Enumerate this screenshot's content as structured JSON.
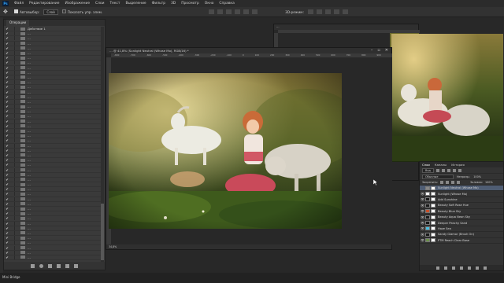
{
  "app": {
    "logo": "Ps",
    "menu": [
      "Файл",
      "Редактирование",
      "Изображение",
      "Слои",
      "Текст",
      "Выделение",
      "Фильтр",
      "3D",
      "Просмотр",
      "Окно",
      "Справка"
    ]
  },
  "options": {
    "autoselect_label": "Автовыбор:",
    "autoselect_value": "Слой",
    "show_controls_label": "Показать упр. элем.",
    "mode_3d_label": "3D-режим:"
  },
  "actions_panel": {
    "tab_label": "Операции",
    "rows": [
      {
        "check": "✔",
        "arrow": "",
        "label": "Действие 1",
        "indent": false,
        "selected": false
      },
      {
        "check": "✔",
        "arrow": "",
        "label": "…",
        "indent": false,
        "selected": false
      },
      {
        "check": "✔",
        "arrow": "",
        "label": "…",
        "indent": false,
        "selected": false
      },
      {
        "check": "✔",
        "arrow": "",
        "label": "…",
        "indent": false,
        "selected": false
      },
      {
        "check": "✔",
        "arrow": "",
        "label": "…",
        "indent": false,
        "selected": false
      },
      {
        "check": "✔",
        "arrow": "",
        "label": "…",
        "indent": false,
        "selected": false
      },
      {
        "check": "✔",
        "arrow": "",
        "label": "…",
        "indent": false,
        "selected": false
      },
      {
        "check": "✔",
        "arrow": "",
        "label": "…",
        "indent": false,
        "selected": false
      },
      {
        "check": "✔",
        "arrow": "",
        "label": "…",
        "indent": false,
        "selected": false
      },
      {
        "check": "✔",
        "arrow": "",
        "label": "…",
        "indent": false,
        "selected": false
      },
      {
        "check": "✔",
        "arrow": "",
        "label": "…",
        "indent": false,
        "selected": false
      },
      {
        "check": "✔",
        "arrow": "",
        "label": "…",
        "indent": false,
        "selected": false
      },
      {
        "check": "✔",
        "arrow": "",
        "label": "…",
        "indent": false,
        "selected": false
      },
      {
        "check": "✔",
        "arrow": "",
        "label": "…",
        "indent": false,
        "selected": false
      },
      {
        "check": "✔",
        "arrow": "",
        "label": "…",
        "indent": false,
        "selected": false
      },
      {
        "check": "✔",
        "arrow": "",
        "label": "…",
        "indent": false,
        "selected": false
      },
      {
        "check": "✔",
        "arrow": "",
        "label": "…",
        "indent": false,
        "selected": false
      },
      {
        "check": "✔",
        "arrow": "",
        "label": "…",
        "indent": false,
        "selected": false
      },
      {
        "check": "✔",
        "arrow": "",
        "label": "…",
        "indent": false,
        "selected": false
      },
      {
        "check": "✔",
        "arrow": "",
        "label": "…",
        "indent": false,
        "selected": false
      },
      {
        "check": "✔",
        "arrow": "",
        "label": "…",
        "indent": false,
        "selected": false
      },
      {
        "check": "✔",
        "arrow": "",
        "label": "…",
        "indent": false,
        "selected": false
      },
      {
        "check": "✔",
        "arrow": "",
        "label": "…",
        "indent": false,
        "selected": false
      },
      {
        "check": "✔",
        "arrow": "",
        "label": "…",
        "indent": false,
        "selected": false
      },
      {
        "check": "✔",
        "arrow": "",
        "label": "…",
        "indent": false,
        "selected": false
      },
      {
        "check": "✔",
        "arrow": "",
        "label": "…",
        "indent": false,
        "selected": false
      },
      {
        "check": "✔",
        "arrow": "",
        "label": "…",
        "indent": false,
        "selected": false
      },
      {
        "check": "✔",
        "arrow": "",
        "label": "…",
        "indent": false,
        "selected": false
      },
      {
        "check": "✔",
        "arrow": "",
        "label": "…",
        "indent": false,
        "selected": false
      },
      {
        "check": "✔",
        "arrow": "",
        "label": "…",
        "indent": false,
        "selected": false
      },
      {
        "check": "✔",
        "arrow": "",
        "label": "…",
        "indent": false,
        "selected": false
      },
      {
        "check": "✔",
        "arrow": "",
        "label": "…",
        "indent": false,
        "selected": false
      },
      {
        "check": "✔",
        "arrow": "",
        "label": "…",
        "indent": false,
        "selected": false
      },
      {
        "check": "✔",
        "arrow": "",
        "label": "…",
        "indent": false,
        "selected": false
      },
      {
        "check": "✔",
        "arrow": "",
        "label": "…",
        "indent": false,
        "selected": false
      },
      {
        "check": "✔",
        "arrow": "",
        "label": "…",
        "indent": false,
        "selected": false
      },
      {
        "check": "✔",
        "arrow": "",
        "label": "…",
        "indent": false,
        "selected": false
      },
      {
        "check": "✔",
        "arrow": "",
        "label": "…",
        "indent": false,
        "selected": false
      },
      {
        "check": "✔",
        "arrow": "",
        "label": "…",
        "indent": false,
        "selected": false
      },
      {
        "check": "✔",
        "arrow": "",
        "label": "…",
        "indent": false,
        "selected": false
      },
      {
        "check": "✔",
        "arrow": "",
        "label": "…",
        "indent": false,
        "selected": false
      },
      {
        "check": "✔",
        "arrow": "",
        "label": "…",
        "indent": false,
        "selected": false
      },
      {
        "check": "✔",
        "arrow": "",
        "label": "…",
        "indent": false,
        "selected": false
      },
      {
        "check": "✔",
        "arrow": "",
        "label": "…",
        "indent": false,
        "selected": false
      },
      {
        "check": "✔",
        "arrow": "",
        "label": "…",
        "indent": false,
        "selected": false
      },
      {
        "check": "✔",
        "arrow": "",
        "label": "…",
        "indent": false,
        "selected": false
      },
      {
        "check": "✔",
        "arrow": "",
        "label": "…",
        "indent": false,
        "selected": false
      },
      {
        "check": "✔",
        "arrow": "",
        "label": "…",
        "indent": false,
        "selected": false
      }
    ],
    "footer_icons": [
      "stop-icon",
      "record-icon",
      "play-icon",
      "new-set-icon",
      "new-action-icon",
      "trash-icon"
    ]
  },
  "document_main": {
    "title": "… @ 41,8% (Sunlight Neutral (Whose Mo), RGB/16) *",
    "ruler_ticks": [
      "-800",
      "-700",
      "-600",
      "-500",
      "-400",
      "-300",
      "-200",
      "-100",
      "0",
      "100",
      "200",
      "300",
      "400",
      "500",
      "600",
      "700",
      "800",
      "900",
      "1000",
      "1100",
      "1200",
      "1300"
    ],
    "status": "34,8%"
  },
  "document_second": {
    "title": "…"
  },
  "layers_panel": {
    "tabs": [
      "Слои",
      "Каналы",
      "История"
    ],
    "filter_label": "Вид",
    "blend_mode": "Обычные",
    "opacity_label": "Непрозр.:",
    "opacity_value": "100%",
    "lock_label": "Закрепить:",
    "fill_label": "Заливка:",
    "fill_value": "100%",
    "rows": [
      {
        "name": "Sunlight Neutral (Whose Mo)",
        "eye": "",
        "thumb_color": "#888888",
        "selected": true
      },
      {
        "name": "Sunlight (Whose Mo)",
        "eye": "👁",
        "thumb_color": "#ffffff",
        "selected": false
      },
      {
        "name": "Add Sunshine",
        "eye": "👁",
        "thumb_color": "#1a1a1a",
        "selected": false
      },
      {
        "name": "Beauty Soft Rose Hue",
        "eye": "👁",
        "thumb_color": "#1a1a1a",
        "selected": false
      },
      {
        "name": "Beauty Blue Sky",
        "eye": "👁",
        "thumb_color": "#c8502a",
        "selected": false
      },
      {
        "name": "Beauty Aqua Neon Sky",
        "eye": "👁",
        "thumb_color": "#1a1a1a",
        "selected": false
      },
      {
        "name": "Deeper Peachy Sand",
        "eye": "👁",
        "thumb_color": "#1a1a1a",
        "selected": false
      },
      {
        "name": "Haze Sea",
        "eye": "👁",
        "thumb_color": "#4ac0e0",
        "selected": false
      },
      {
        "name": "Sandy Glamor (Brush On)",
        "eye": "👁",
        "thumb_color": "#1a1a1a",
        "selected": false
      },
      {
        "name": "PTM Reach Clear Base",
        "eye": "👁",
        "thumb_color": "#6b8f4a",
        "selected": false
      }
    ]
  },
  "bottom": {
    "label": "Mini Bridge"
  },
  "colors": {
    "accent": "#5b6f8e"
  }
}
